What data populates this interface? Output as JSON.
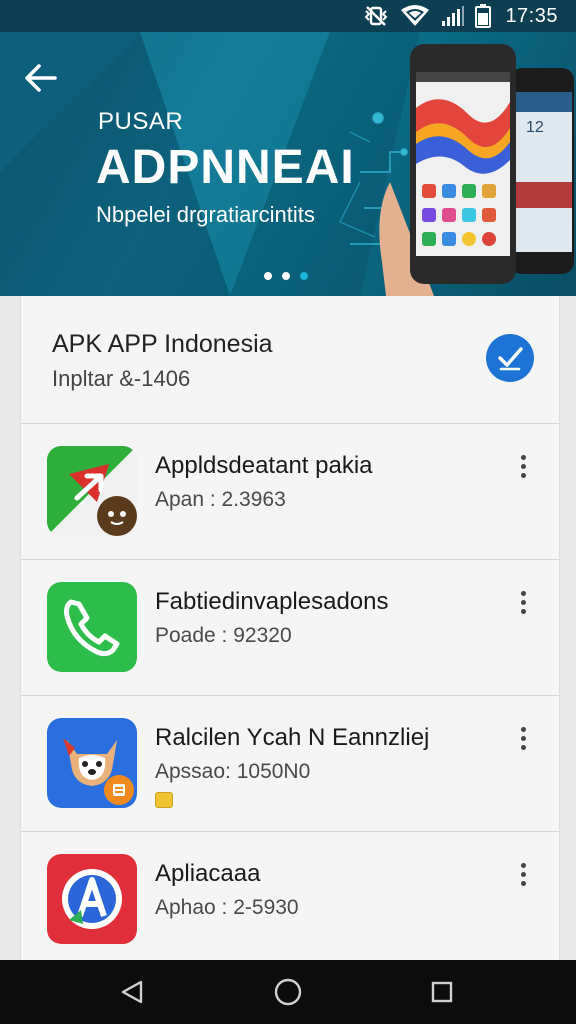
{
  "status_bar": {
    "time": "17:35",
    "icons": [
      "vibrate-off-icon",
      "wifi-icon",
      "signal-icon",
      "battery-icon"
    ]
  },
  "banner": {
    "kicker": "PUSAR",
    "title": "ADPNNEAI",
    "subtitle": "Nbpelei drgratiarcintits",
    "active_slide": 2,
    "slide_count": 3
  },
  "header": {
    "title": "APK APP Indonesia",
    "subtitle": "Inpltar &-1406"
  },
  "apps": [
    {
      "name": "Appldsdeatant pakia",
      "meta": "Apan : 2.3963",
      "icon": "arrow-map-app-icon"
    },
    {
      "name": "Fabtiedinvaplesadons",
      "meta": "Poade : 92320",
      "icon": "phone-app-icon"
    },
    {
      "name": "Ralcilen Ycah N Eannzliej",
      "meta": "Apssao: 1050N0",
      "icon": "dog-app-icon"
    },
    {
      "name": "Apliacaaa",
      "meta": "Aphao : 2-5930",
      "icon": "a-letter-app-icon"
    }
  ],
  "colors": {
    "banner": "#117894",
    "accent": "#1e74d6",
    "nav_bar": "#0c0c0c"
  }
}
